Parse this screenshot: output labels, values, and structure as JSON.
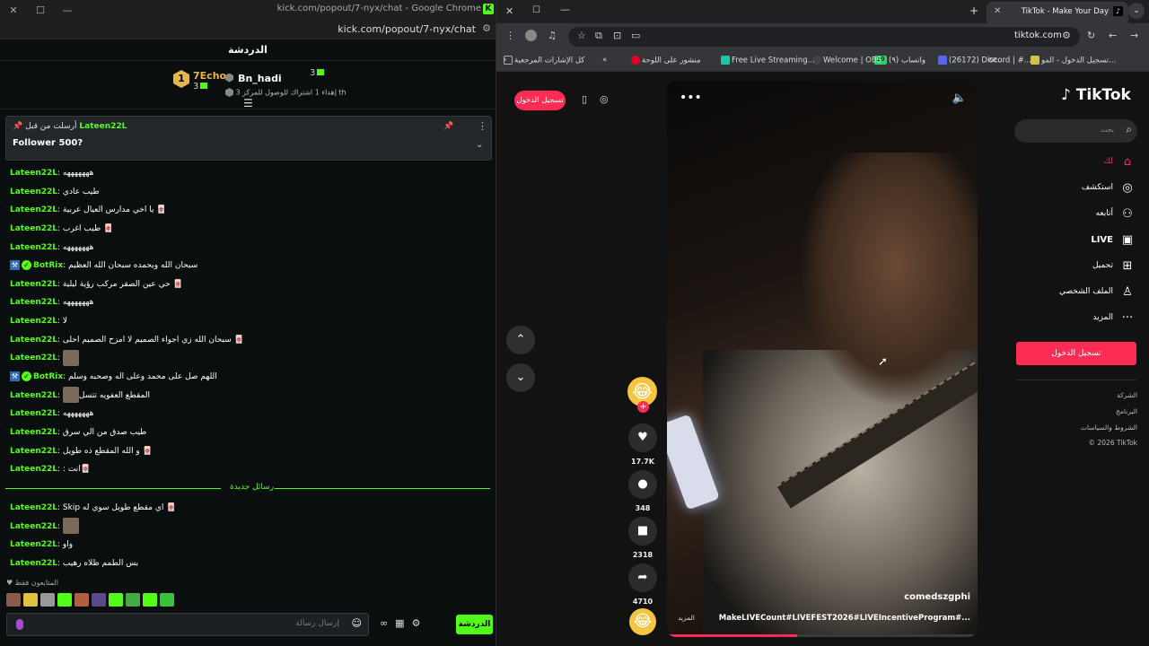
{
  "kick": {
    "window_title": "kick.com/popout/7-nyx/chat - Google Chrome",
    "url": "kick.com/popout/7-nyx/chat",
    "header_title": "الدردشة",
    "gifts": {
      "first_name": "7Echo",
      "first_rank": "1",
      "first_count": "3",
      "second_name": "Bn_hadi",
      "second_count": "3",
      "second_sub": "إهداء 1 اشتراك للوصول للمركز 3 th"
    },
    "pinned": {
      "label": "أرسلت من قبل",
      "author": "Lateen22L",
      "text": "Follower 500?"
    },
    "messages": [
      {
        "user": "Lateen22L",
        "text": "هههههههه"
      },
      {
        "user": "Lateen22L",
        "text": "طيب عادي"
      },
      {
        "user": "Lateen22L",
        "text": "يا اخي مدارس العيال عربية 🀄"
      },
      {
        "user": "Lateen22L",
        "text": "طيب اغرب 🀄"
      },
      {
        "user": "Lateen22L",
        "text": "هههههههه"
      },
      {
        "user": "BotRix",
        "text": "سبحان الله وبحمده سبحان الله العظيم",
        "bot": true
      },
      {
        "user": "Lateen22L",
        "text": "حي عين الصقر مركب رؤية ليلية 🀄"
      },
      {
        "user": "Lateen22L",
        "text": "هههههههه"
      },
      {
        "user": "Lateen22L",
        "text": "لا"
      },
      {
        "user": "Lateen22L",
        "text": "سبحان الله زي اجواء الصميم لا امزح الصميم احلى 🀄"
      },
      {
        "user": "Lateen22L",
        "text": "",
        "emote": true
      },
      {
        "user": "BotRix",
        "text": "اللهم صل على محمد وعلى اله وصحبه وسلم",
        "bot": true
      },
      {
        "user": "Lateen22L",
        "text": "المقطع العفويه تتسل",
        "emote": true
      },
      {
        "user": "Lateen22L",
        "text": "هههههههه"
      },
      {
        "user": "Lateen22L",
        "text": "طيب صدق من الي سرق"
      },
      {
        "user": "Lateen22L",
        "text": "و الله المقطع ذه طويل 🀄"
      },
      {
        "user": "Lateen22L",
        "text": ": انت🀄"
      }
    ],
    "new_messages_label": "رسائل جديدة",
    "messages_after": [
      {
        "user": "Lateen22L",
        "text": "Skip اي مقطع طويل سوي له 🀄"
      },
      {
        "user": "Lateen22L",
        "text": "",
        "emote": true
      },
      {
        "user": "Lateen22L",
        "text": "واو"
      },
      {
        "user": "Lateen22L",
        "text": "بس الطمم ظلاه رهيب"
      }
    ],
    "subscribers_only": "المتابعون فقط",
    "input_placeholder": "إرسال رسالة",
    "send_label": "الدردشة"
  },
  "chrome": {
    "tab_title": "TikTok - Make Your Day",
    "url": "tiktok.com",
    "bookmarks": [
      "تسجيل الدخول - المو...",
      "ce...",
      "(26172) Discord | #...",
      "(٩) واتساب",
      "19",
      "Welcome | OBS",
      "Free Live Streaming...",
      "منشور على اللوحة",
      "كل الإشارات المرجعية"
    ]
  },
  "tiktok": {
    "login_top": "تسجيل الدخول",
    "logo": "TikTok",
    "search_placeholder": "بحث",
    "nav": [
      {
        "label": "لك",
        "icon": "home-icon"
      },
      {
        "label": "استكشف",
        "icon": "compass-icon"
      },
      {
        "label": "أتابعه",
        "icon": "user-plus-icon"
      },
      {
        "label": "LIVE",
        "icon": "live-icon"
      },
      {
        "label": "تحميل",
        "icon": "upload-icon"
      },
      {
        "label": "الملف الشخصي",
        "icon": "profile-icon"
      },
      {
        "label": "المزيد",
        "icon": "more-icon"
      }
    ],
    "login_button": "تسجيل الدخول",
    "footer": [
      "الشركة",
      "البرنامج",
      "الشروط والسياسات",
      "© 2026 TikTok"
    ],
    "video": {
      "author": "comedszgphi",
      "caption": "MakeLIVECount#LIVEFEST2026#LIVEIncentiveProgram#...",
      "more": "المزيد",
      "progress": 0.42
    },
    "actions": {
      "likes": "17.7K",
      "comments": "348",
      "saves": "2318",
      "shares": "4710"
    }
  },
  "colors": {
    "kick_green": "#53fc18",
    "tiktok_red": "#fe2c55"
  }
}
